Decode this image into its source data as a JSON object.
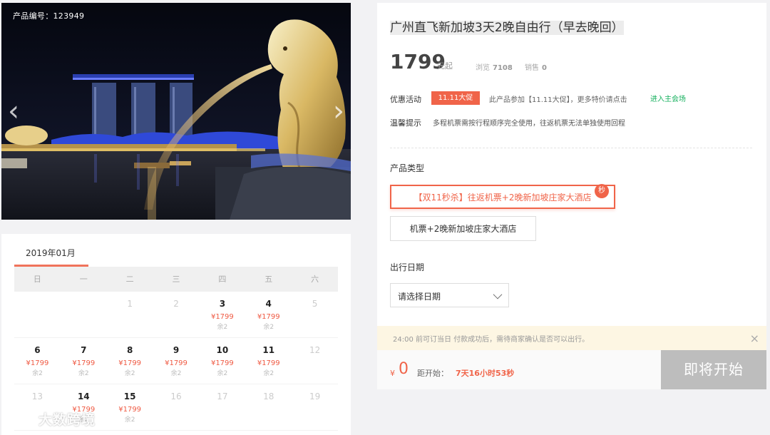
{
  "photo": {
    "product_id_label": "产品编号：123949",
    "prev_icon": "chevron-left-icon",
    "next_icon": "chevron-right-icon"
  },
  "calendar": {
    "month_tab": "2019年01月",
    "weekdays": [
      "日",
      "一",
      "二",
      "三",
      "四",
      "五",
      "六"
    ],
    "rows": [
      [
        {
          "day": "",
          "price": "",
          "stock": "",
          "available": false
        },
        {
          "day": "",
          "price": "",
          "stock": "",
          "available": false
        },
        {
          "day": "1",
          "price": "",
          "stock": "",
          "available": false
        },
        {
          "day": "2",
          "price": "",
          "stock": "",
          "available": false
        },
        {
          "day": "3",
          "price": "¥1799",
          "stock": "余2",
          "available": true
        },
        {
          "day": "4",
          "price": "¥1799",
          "stock": "余2",
          "available": true
        },
        {
          "day": "5",
          "price": "",
          "stock": "",
          "available": false
        }
      ],
      [
        {
          "day": "6",
          "price": "¥1799",
          "stock": "余2",
          "available": true
        },
        {
          "day": "7",
          "price": "¥1799",
          "stock": "余2",
          "available": true
        },
        {
          "day": "8",
          "price": "¥1799",
          "stock": "余2",
          "available": true
        },
        {
          "day": "9",
          "price": "¥1799",
          "stock": "余2",
          "available": true
        },
        {
          "day": "10",
          "price": "¥1799",
          "stock": "余2",
          "available": true
        },
        {
          "day": "11",
          "price": "¥1799",
          "stock": "余2",
          "available": true
        },
        {
          "day": "12",
          "price": "",
          "stock": "",
          "available": false
        }
      ],
      [
        {
          "day": "13",
          "price": "",
          "stock": "",
          "available": false
        },
        {
          "day": "14",
          "price": "¥1799",
          "stock": "余2",
          "available": true
        },
        {
          "day": "15",
          "price": "¥1799",
          "stock": "余2",
          "available": true
        },
        {
          "day": "16",
          "price": "",
          "stock": "",
          "available": false
        },
        {
          "day": "17",
          "price": "",
          "stock": "",
          "available": false
        },
        {
          "day": "18",
          "price": "",
          "stock": "",
          "available": false
        },
        {
          "day": "19",
          "price": "",
          "stock": "",
          "available": false
        }
      ]
    ]
  },
  "watermark": {
    "text": "大数跨境",
    "icon": "brand-logo-icon"
  },
  "product": {
    "title": "广州直飞新加坡3天2晚自由行（早去晚回）",
    "price": "1799",
    "price_unit": "元起",
    "views_label": "浏览",
    "views": "7108",
    "sales_label": "销售",
    "sales": "0"
  },
  "promo": {
    "label": "优惠活动",
    "badge": "11.11大促",
    "text": "此产品参加【11.11大促】，更多特价请点击",
    "link": "进入主会场"
  },
  "tip": {
    "label": "温馨提示",
    "text": "多程机票需按行程顺序完全使用，往返机票无法单独使用回程"
  },
  "product_type": {
    "label": "产品类型",
    "options": [
      {
        "label": "【双11秒杀】往返机票+2晚新加坡庄家大酒店",
        "badge": "秒",
        "selected": true
      },
      {
        "label": "机票+2晚新加坡庄家大酒店",
        "selected": false
      }
    ]
  },
  "travel_date": {
    "label": "出行日期",
    "select_value": "请选择日期"
  },
  "notice": {
    "text": "24:00 前可订当日 付款成功后，需待商家确认是否可以出行。",
    "close": "×"
  },
  "buy": {
    "yen": "¥",
    "count": "0",
    "countdown_label": "距开始：",
    "countdown_time": "7天16小时53秒",
    "start_button": "即将开始"
  },
  "colors": {
    "accent": "#f06449",
    "link": "#18b15f",
    "disabled": "#bdbdbd"
  }
}
